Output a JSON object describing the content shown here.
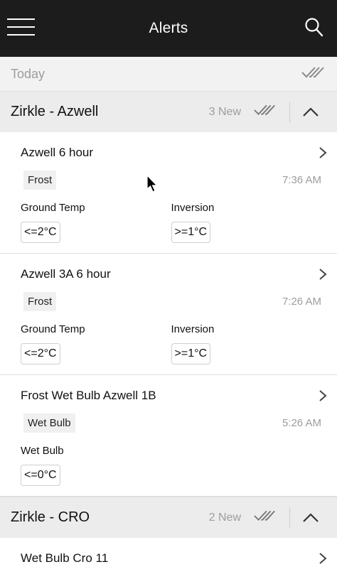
{
  "header": {
    "title": "Alerts",
    "menu_icon": "hamburger-icon",
    "search_icon": "search-icon"
  },
  "today": {
    "label": "Today",
    "mark_all_icon": "double-check-icon"
  },
  "groups": [
    {
      "name": "Zirkle - Azwell",
      "new_count": "3 New",
      "alerts": [
        {
          "title": "Azwell 6 hour",
          "tag": "Frost",
          "time": "7:36 AM",
          "conditions": [
            {
              "label": "Ground Temp",
              "value": "<=2°C"
            },
            {
              "label": "Inversion",
              "value": ">=1°C"
            }
          ]
        },
        {
          "title": "Azwell 3A 6 hour",
          "tag": "Frost",
          "time": "7:26 AM",
          "conditions": [
            {
              "label": "Ground Temp",
              "value": "<=2°C"
            },
            {
              "label": "Inversion",
              "value": ">=1°C"
            }
          ]
        },
        {
          "title": "Frost Wet Bulb Azwell 1B",
          "tag": "Wet Bulb",
          "time": "5:26 AM",
          "conditions": [
            {
              "label": "Wet Bulb",
              "value": "<=0°C"
            }
          ]
        }
      ]
    },
    {
      "name": "Zirkle - CRO",
      "new_count": "2 New",
      "alerts": [
        {
          "title": "Wet Bulb Cro 11"
        }
      ]
    }
  ],
  "colors": {
    "topbar": "#1c1c1c",
    "section_bg": "#ececec",
    "muted_text": "#9d9d9d"
  }
}
